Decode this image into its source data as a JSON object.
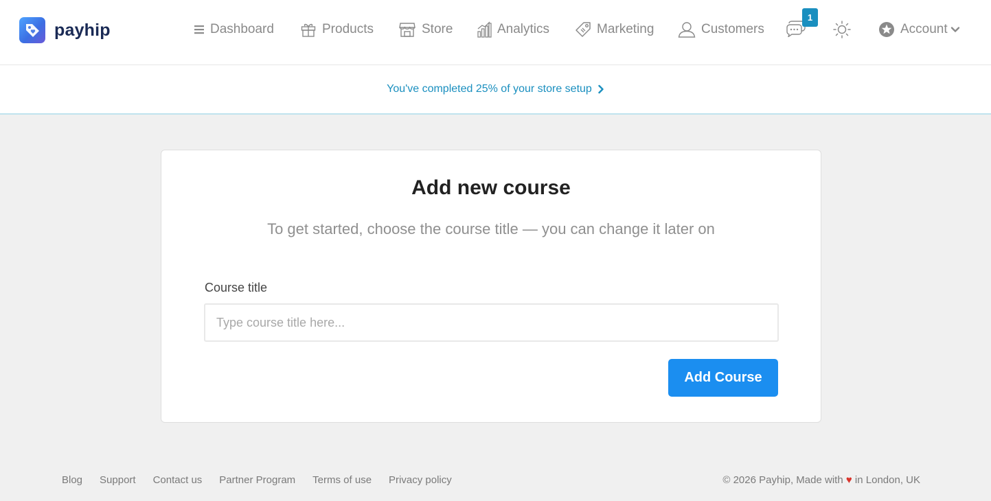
{
  "brand": {
    "name": "payhip"
  },
  "nav": {
    "dashboard": "Dashboard",
    "products": "Products",
    "store": "Store",
    "analytics": "Analytics",
    "marketing": "Marketing",
    "customers": "Customers",
    "chat_badge": "1",
    "account": "Account"
  },
  "setup": {
    "text": "You've completed 25% of your store setup",
    "progress_percent": 25
  },
  "card": {
    "title": "Add new course",
    "subtitle": "To get started, choose the course title — you can change it later on",
    "field_label": "Course title",
    "input_value": "",
    "input_placeholder": "Type course title here...",
    "submit_label": "Add Course"
  },
  "footer": {
    "links": [
      "Blog",
      "Support",
      "Contact us",
      "Partner Program",
      "Terms of use",
      "Privacy policy"
    ],
    "copyright_prefix": "© 2026 Payhip, Made with",
    "heart": "♥",
    "copyright_suffix": "in London, UK"
  },
  "colors": {
    "accent": "#1b8ef0",
    "link": "#1a8fbf",
    "brand_dark": "#1a2a55",
    "heart": "#d9342b",
    "page_bg": "#f0f0f0"
  },
  "icons": [
    "menu-icon",
    "gift-icon",
    "store-icon",
    "analytics-icon",
    "tag-icon",
    "user-icon",
    "chat-icon",
    "sun-icon",
    "star-badge-icon",
    "chevron-down-icon",
    "chevron-right-icon"
  ]
}
